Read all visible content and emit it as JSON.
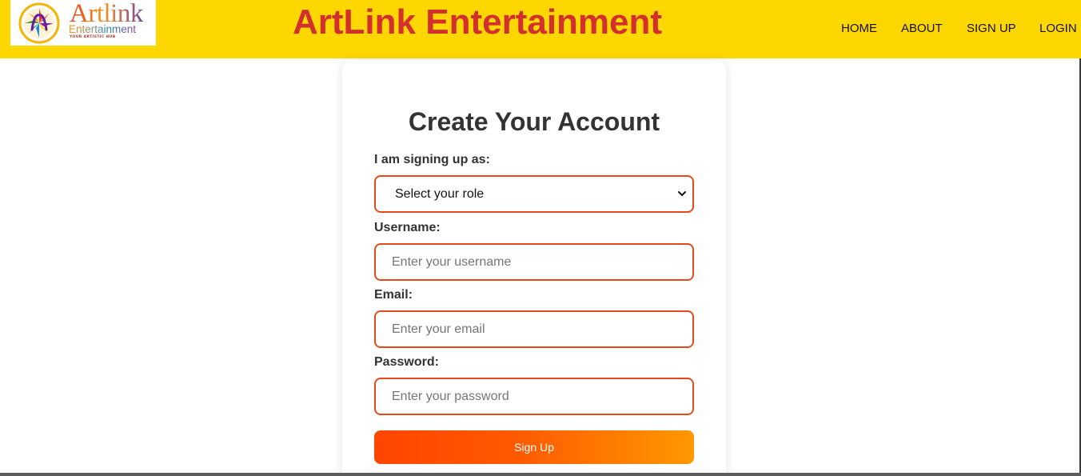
{
  "header": {
    "logo": {
      "wordmark": "Artlink",
      "subtitle": "Entertainment",
      "tagline": "YOUR ARTISTIC HUB",
      "icon": "artlink-logo-icon"
    },
    "brand_title": "ArtLink Entertainment",
    "nav": [
      {
        "label": "HOME"
      },
      {
        "label": "ABOUT"
      },
      {
        "label": "SIGN UP"
      },
      {
        "label": "LOGIN"
      }
    ],
    "background_color": "#ffd700",
    "title_color": "#d32f2f"
  },
  "form": {
    "title": "Create Your Account",
    "role": {
      "label": "I am signing up as:",
      "selected": "Select your role",
      "icon": "chevron-down-icon"
    },
    "username": {
      "label": "Username:",
      "value": "",
      "placeholder": "Enter your username"
    },
    "email": {
      "label": "Email:",
      "value": "",
      "placeholder": "Enter your email"
    },
    "password": {
      "label": "Password:",
      "value": "",
      "placeholder": "Enter your password"
    },
    "submit_label": "Sign Up",
    "field_border_color": "#e64a19",
    "button_gradient": [
      "#ff4500",
      "#ff9800"
    ]
  }
}
